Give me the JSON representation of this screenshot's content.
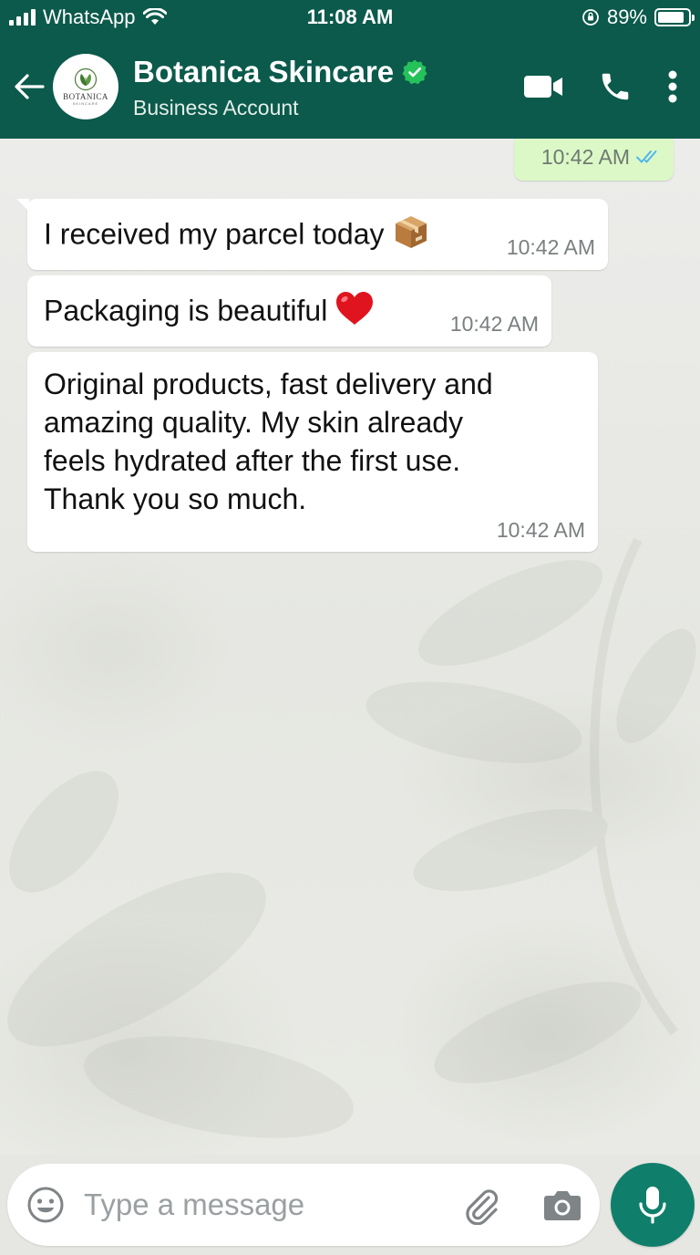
{
  "status_bar": {
    "carrier": "WhatsApp",
    "time": "11:08 AM",
    "battery": "89%",
    "battery_level": 0.89
  },
  "header": {
    "contact_name": "Botanica Skincare",
    "contact_subtitle": "Business Account",
    "avatar_brand": "BOTANICA",
    "avatar_sub": "SKINCARE",
    "verified": true,
    "icons": [
      "back-arrow-icon",
      "video-call-icon",
      "voice-call-icon",
      "more-options-icon"
    ]
  },
  "messages": [
    {
      "direction": "outgoing",
      "time": "10:42 AM",
      "status": "read",
      "text": ""
    },
    {
      "direction": "incoming",
      "text": "I received my parcel today",
      "emoji": "package-emoji",
      "time": "10:42 AM"
    },
    {
      "direction": "incoming",
      "text": "Packaging is beautiful",
      "emoji": "red-heart-emoji",
      "time": "10:42 AM"
    },
    {
      "direction": "incoming",
      "lines": [
        "Original products, fast delivery and",
        "amazing quality. My skin already",
        "feels hydrated after the first use.",
        "Thank you so much."
      ],
      "time": "10:42 AM"
    }
  ],
  "input": {
    "placeholder": "Type a message",
    "value": ""
  },
  "colors": {
    "header": "#0b5a4b",
    "outgoing_bubble": "#dcf8c6",
    "incoming_bubble": "#ffffff",
    "read_ticks": "#4fb6ec",
    "verified_badge": "#25c25b",
    "mic_button": "#0f7f6b"
  }
}
